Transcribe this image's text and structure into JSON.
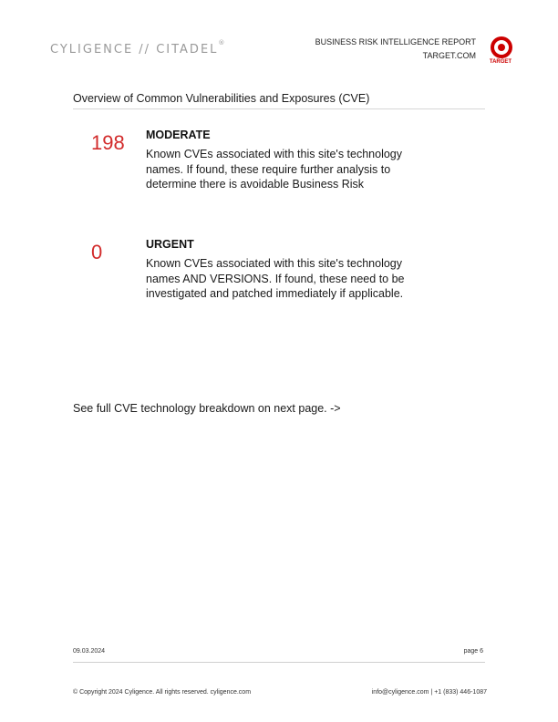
{
  "header": {
    "brand": "CYLIGENCE // CITADEL",
    "brand_mark": "®",
    "report_title": "BUSINESS RISK INTELLIGENCE REPORT",
    "report_domain": "TARGET.COM",
    "logo_text": "TARGET",
    "logo_color": "#cc0000"
  },
  "section": {
    "title": "Overview of Common Vulnerabilities and Exposures (CVE)"
  },
  "items": [
    {
      "count": "198",
      "severity": "MODERATE",
      "description": "Known CVEs associated with this site's technology names. If found, these require further analysis to determine there is avoidable Business Risk"
    },
    {
      "count": "0",
      "severity": "URGENT",
      "description": "Known CVEs associated with this site's technology names AND VERSIONS. If found, these need to be investigated and patched immediately if applicable."
    }
  ],
  "note": "See full CVE technology breakdown on next page. ->",
  "footer": {
    "date": "09.03.2024",
    "page": "page 6",
    "copyright": "© Copyright 2024 Cyligence. All rights reserved. cyligence.com",
    "contact": "info@cyligence.com  |  +1 (833) 446-1087"
  },
  "colors": {
    "accent": "#d22b2b"
  }
}
